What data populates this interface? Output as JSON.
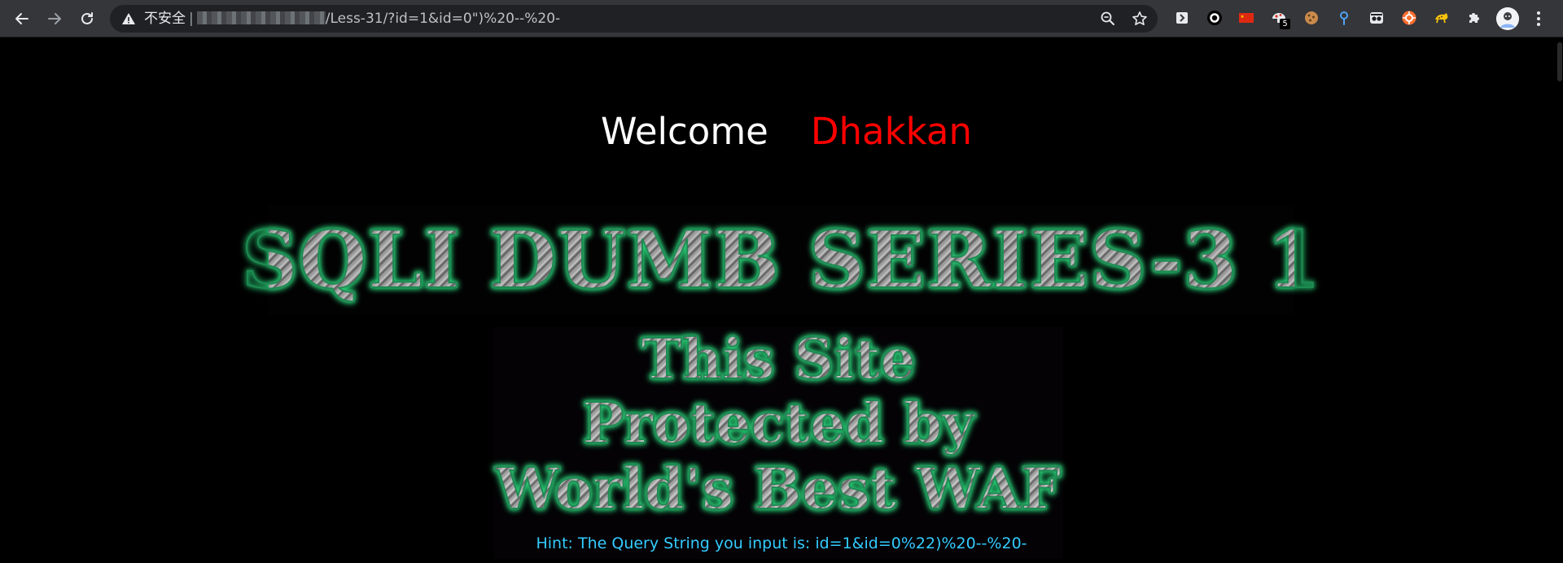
{
  "browser": {
    "security_label": "不安全",
    "separator": "|",
    "url_path": "/Less-31/?id=1&id=0\")%20--%20-",
    "extension_badge": "5",
    "accent_color": "#8ab4f8"
  },
  "page": {
    "welcome_label": "Welcome",
    "welcome_name": "Dhakkan",
    "banner_title": "SQLI DUMB SERIES-3 1",
    "waf_lines": [
      "This Site",
      "Protected by",
      "World's Best WAF"
    ],
    "hint_label": "Hint: The Query String you input is:",
    "hint_value": "id=1&id=0%22)%20--%20-",
    "colors": {
      "welcome": "#ffffff",
      "name": "#ff0000",
      "hint": "#33ccff",
      "glow": "#2bd67b"
    }
  }
}
